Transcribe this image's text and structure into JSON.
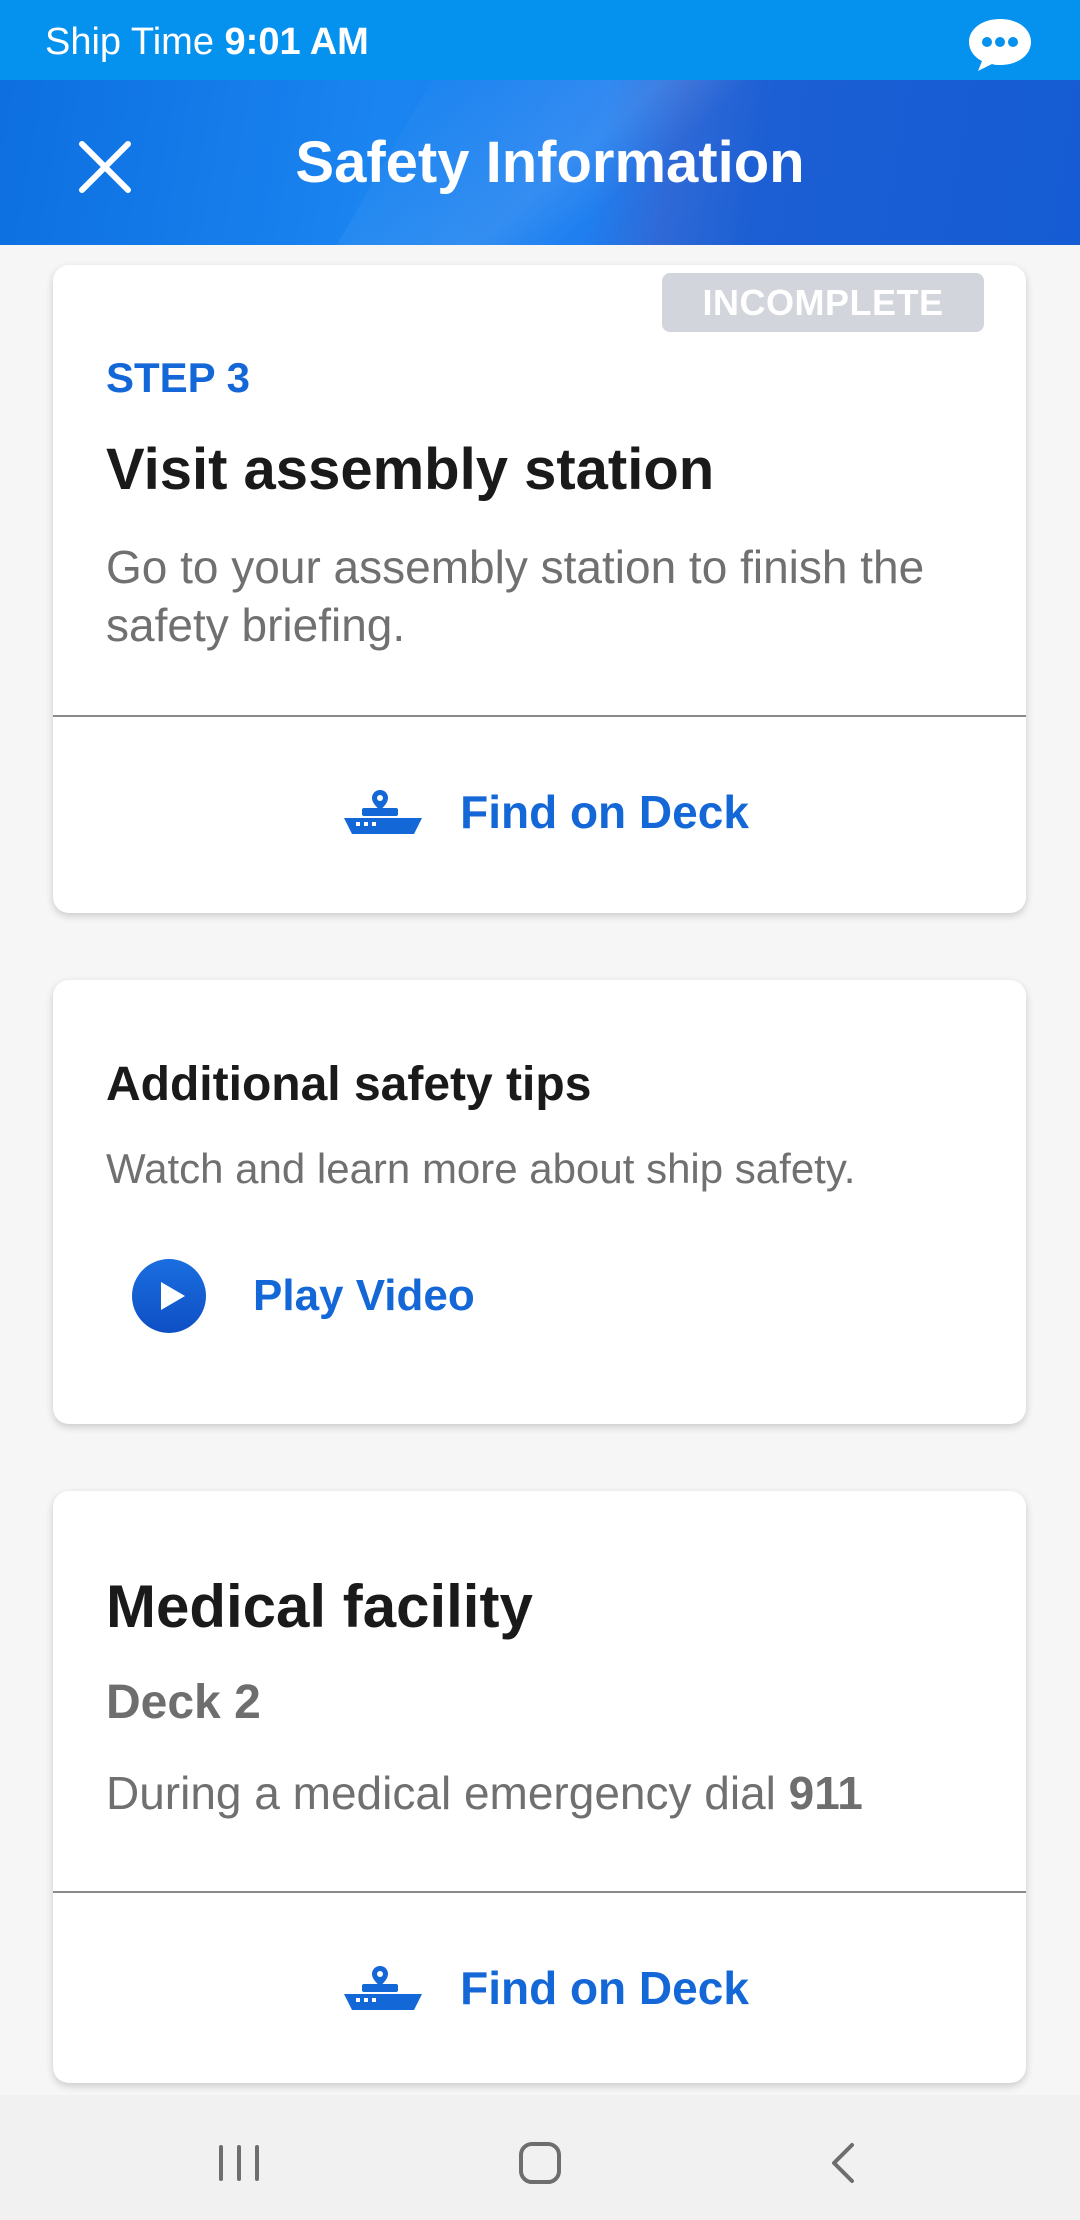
{
  "status_bar": {
    "ship_time_label": "Ship Time",
    "time": "9:01 AM",
    "chat_icon": "chat-bubble-icon"
  },
  "header": {
    "title": "Safety Information",
    "close_icon": "close-icon"
  },
  "steps_card": {
    "badge": "INCOMPLETE",
    "step_label": "STEP 3",
    "title": "Visit assembly station",
    "description": "Go to your assembly station to finish the safety briefing.",
    "action_label": "Find on Deck",
    "action_icon": "ship-location-icon"
  },
  "tips_card": {
    "title": "Additional safety tips",
    "description": "Watch and learn more about ship safety.",
    "action_label": "Play Video",
    "action_icon": "play-icon"
  },
  "medical_card": {
    "title": "Medical facility",
    "deck": "Deck 2",
    "description": "During a medical emergency dial",
    "emergency_number": "911",
    "action_label": "Find on Deck",
    "action_icon": "ship-location-icon"
  },
  "nav_bar": {
    "recents_icon": "recents-icon",
    "home_icon": "home-icon",
    "back_icon": "back-icon"
  },
  "colors": {
    "status_bar": "#0591ee",
    "header": "#1a84f0",
    "accent": "#1467d6",
    "badge_bg": "#d2d5db"
  }
}
